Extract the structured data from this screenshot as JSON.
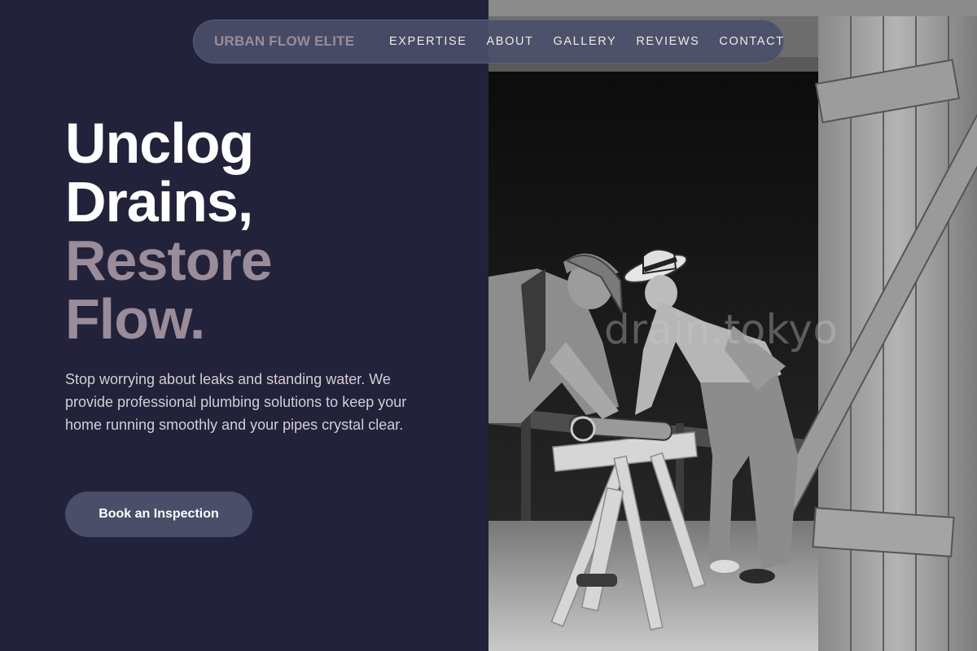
{
  "nav": {
    "brand": "URBAN FLOW ELITE",
    "links": [
      {
        "label": "EXPERTISE"
      },
      {
        "label": "ABOUT"
      },
      {
        "label": "GALLERY"
      },
      {
        "label": "REVIEWS"
      },
      {
        "label": "CONTACT"
      }
    ]
  },
  "hero": {
    "headline_lines": [
      "Unclog",
      "Drains,",
      "Restore",
      "Flow."
    ],
    "description": "Stop worrying about leaks and standing water. We provide professional plumbing solutions to keep your home running smoothly and your pipes crystal clear.",
    "cta_label": "Book an Inspection"
  },
  "photo": {
    "watermark": "drain.tokyo"
  },
  "colors": {
    "background": "#22223b",
    "accent": "#4a4e69",
    "muted": "#9a8c98",
    "text_light": "#f2e9e4"
  }
}
